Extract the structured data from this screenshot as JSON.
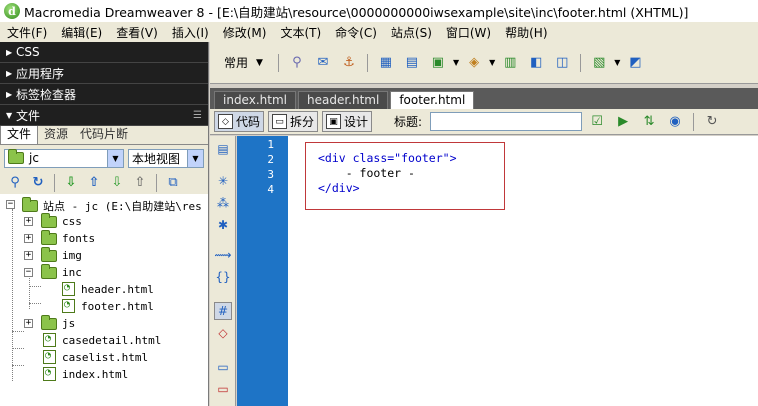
{
  "window": {
    "title": "Macromedia Dreamweaver 8 - [E:\\自助建站\\resource\\0000000000iwsexample\\site\\inc\\footer.html (XHTML)]"
  },
  "menu": [
    "文件(F)",
    "编辑(E)",
    "查看(V)",
    "插入(I)",
    "修改(M)",
    "文本(T)",
    "命令(C)",
    "站点(S)",
    "窗口(W)",
    "帮助(H)"
  ],
  "panels": {
    "css": "CSS",
    "app": "应用程序",
    "inspector": "标签检查器",
    "files": "文件"
  },
  "files_panel": {
    "tabs": [
      "文件",
      "资源",
      "代码片断"
    ],
    "site_select": "jc",
    "view_select": "本地视图",
    "tree": {
      "root": "站点 - jc (E:\\自助建站\\res",
      "folders": [
        "css",
        "fonts",
        "img",
        "inc"
      ],
      "inc_files": [
        "header.html",
        "footer.html"
      ],
      "after": [
        "js"
      ],
      "files": [
        "casedetail.html",
        "caselist.html",
        "index.html"
      ]
    }
  },
  "insert_bar": {
    "category": "常用"
  },
  "document_tabs": [
    "index.html",
    "header.html",
    "footer.html"
  ],
  "document_toolbar": {
    "code": "代码",
    "split": "拆分",
    "design": "设计",
    "title_label": "标题:",
    "title_value": ""
  },
  "code": {
    "line_numbers": [
      "1",
      "2",
      "3",
      "4"
    ],
    "line1_tag_open": "<div",
    "line1_attr": " class=",
    "line1_value": "\"footer\"",
    "line1_close": ">",
    "line2": "    - footer -",
    "line3": "</div>"
  }
}
